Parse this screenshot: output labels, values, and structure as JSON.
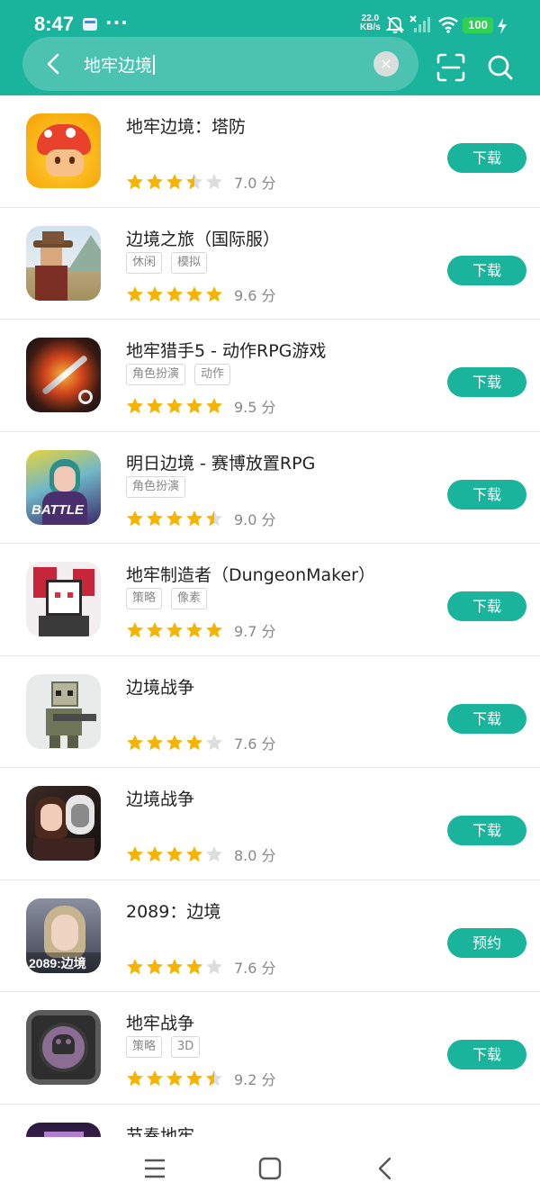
{
  "status_bar": {
    "time": "8:47",
    "more": "···",
    "net_speed": "22.0",
    "net_unit": "KB/s",
    "battery": "100",
    "icons": [
      "mail-notification-icon",
      "mute-bell-icon",
      "no-sim-signal-icon",
      "wifi-icon",
      "charging-icon"
    ]
  },
  "search": {
    "query": "地牢边境",
    "clear_glyph": "×"
  },
  "accent_color": "#1ab39b",
  "apps": [
    {
      "title": "地牢边境：塔防",
      "tags": [],
      "stars": [
        1,
        1,
        1,
        0.5,
        0
      ],
      "score": "7.0 分",
      "button": "下载",
      "icon": "orange-mushroom-icon"
    },
    {
      "title": "边境之旅（国际服）",
      "tags": [
        "休闲",
        "模拟"
      ],
      "stars": [
        1,
        1,
        1,
        1,
        1
      ],
      "score": "9.6 分",
      "button": "下载",
      "icon": "cowboy-voxel-icon"
    },
    {
      "title": "地牢猎手5 - 动作RPG游戏",
      "tags": [
        "角色扮演",
        "动作"
      ],
      "stars": [
        1,
        1,
        1,
        1,
        1
      ],
      "score": "9.5 分",
      "button": "下载",
      "icon": "flaming-sword-icon"
    },
    {
      "title": "明日边境 - 赛博放置RPG",
      "tags": [
        "角色扮演"
      ],
      "stars": [
        1,
        1,
        1,
        1,
        0.5
      ],
      "score": "9.0 分",
      "button": "下载",
      "icon": "cyber-girl-icon"
    },
    {
      "title": "地牢制造者（DungeonMaker）",
      "tags": [
        "策略",
        "像素"
      ],
      "stars": [
        1,
        1,
        1,
        1,
        1
      ],
      "score": "9.7 分",
      "button": "下载",
      "icon": "pixel-demon-girl-icon"
    },
    {
      "title": "边境战争",
      "tags": [],
      "stars": [
        1,
        1,
        1,
        1,
        0
      ],
      "score": "7.6 分",
      "button": "下载",
      "icon": "blocky-soldier-icon"
    },
    {
      "title": "边境战争",
      "tags": [],
      "stars": [
        1,
        1,
        1,
        1,
        0
      ],
      "score": "8.0 分",
      "button": "下载",
      "icon": "anime-duo-icon"
    },
    {
      "title": "2089：边境",
      "tags": [],
      "stars": [
        1,
        1,
        1,
        1,
        0
      ],
      "score": "7.6 分",
      "button": "预约",
      "icon": "portrait-2089-icon",
      "icon_text": "2089:边境"
    },
    {
      "title": "地牢战争",
      "tags": [
        "策略",
        "3D"
      ],
      "stars": [
        1,
        1,
        1,
        1,
        0.5
      ],
      "score": "9.2 分",
      "button": "下载",
      "icon": "skull-shield-icon"
    },
    {
      "title": "节奏地牢",
      "tags": [],
      "stars": [],
      "score": "",
      "button": "",
      "icon": "purple-pixel-icon"
    }
  ],
  "nav": {
    "items": [
      "menu-icon",
      "home-square-icon",
      "back-triangle-icon"
    ]
  }
}
